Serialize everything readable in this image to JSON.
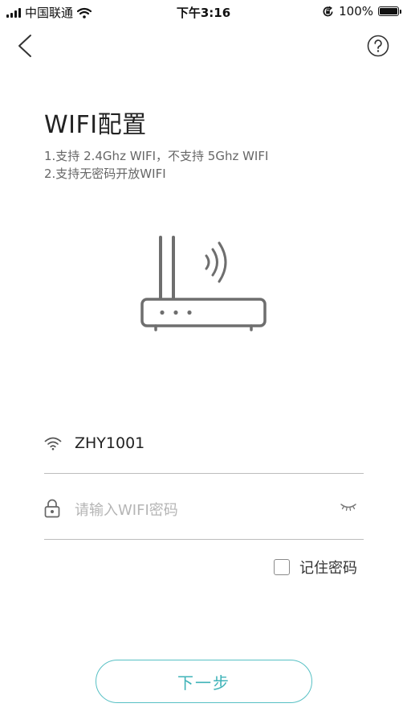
{
  "status_bar": {
    "carrier": "中国联通",
    "time": "下午3:16",
    "battery": "100%",
    "battery_level": 1.0
  },
  "nav": {
    "back_icon": "chevron-left-icon",
    "help_icon": "question-circle-icon"
  },
  "page": {
    "title": "WIFI配置",
    "tips": [
      "1.支持 2.4Ghz WIFI，不支持 5Ghz WIFI",
      "2.支持无密码开放WIFI"
    ]
  },
  "form": {
    "ssid": "ZHY1001",
    "password_value": "",
    "password_placeholder": "请输入WIFI密码",
    "remember_label": "记住密码",
    "remember_checked": false
  },
  "actions": {
    "next_label": "下一步"
  },
  "colors": {
    "accent": "#57c0c4",
    "accent_text": "#3fb3b8",
    "icon_gray": "#6e6e6e",
    "divider": "#bcbcbc"
  }
}
